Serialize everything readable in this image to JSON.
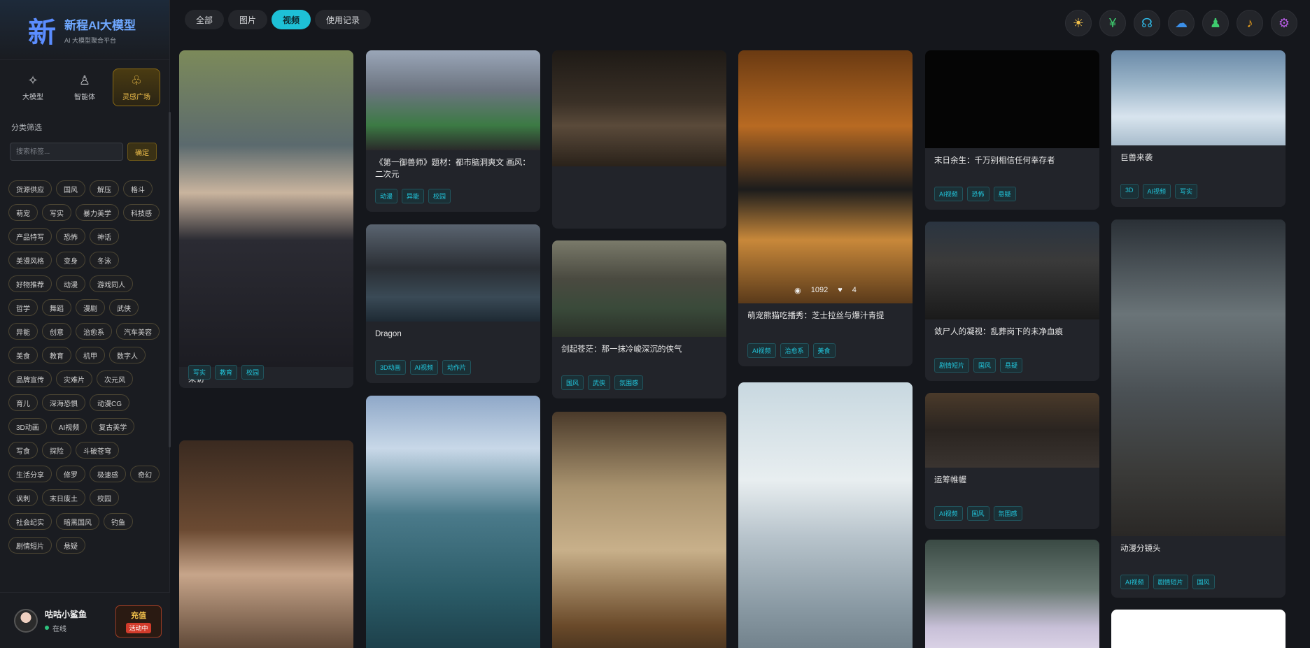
{
  "brand": {
    "logo": "新",
    "title": "新程AI大模型",
    "subtitle": "AI 大模型聚合平台"
  },
  "nav": [
    {
      "label": "大模型",
      "icon": "✧"
    },
    {
      "label": "智能体",
      "icon": "♙"
    },
    {
      "label": "灵感广场",
      "icon": "♧"
    }
  ],
  "filter": {
    "title": "分类筛选",
    "placeholder": "搜索标签...",
    "confirm": "确定"
  },
  "tags": [
    "货源供应",
    "国风",
    "解压",
    "格斗",
    "萌宠",
    "写实",
    "暴力美学",
    "科技感",
    "产品特写",
    "恐怖",
    "神话",
    "美漫风格",
    "变身",
    "冬泳",
    "好物推荐",
    "动漫",
    "游戏同人",
    "哲学",
    "舞蹈",
    "漫剧",
    "武侠",
    "异能",
    "创意",
    "治愈系",
    "汽车美容",
    "美食",
    "教育",
    "机甲",
    "数字人",
    "品牌宣传",
    "灾难片",
    "次元风",
    "育儿",
    "深海恐惧",
    "动漫CG",
    "3D动画",
    "AI视频",
    "复古美学",
    "写食",
    "探险",
    "斗破苍穹",
    "生活分享",
    "修罗",
    "极速感",
    "奇幻",
    "讽刺",
    "末日废土",
    "校园",
    "社会纪实",
    "暗黑国风",
    "钓鱼",
    "剧情短片",
    "悬疑"
  ],
  "user": {
    "name": "咕咕小鲨鱼",
    "status": "在线",
    "recharge": "充值",
    "badge": "活动中"
  },
  "filter_tabs": [
    "全部",
    "图片",
    "视频",
    "使用记录"
  ],
  "cards": [
    {
      "title": "采访",
      "tags": [
        "写实",
        "教育",
        "校园"
      ]
    },
    {
      "title": "",
      "tags": []
    },
    {
      "title": "《第一御兽师》题材：都市脑洞爽文 画风：二次元",
      "tags": [
        "动漫",
        "异能",
        "校园"
      ]
    },
    {
      "title": "Dragon",
      "tags": [
        "3D动画",
        "AI视频",
        "动作片"
      ]
    },
    {
      "title": "",
      "tags": []
    },
    {
      "title": "",
      "tags": []
    },
    {
      "title": "剑起苍茫：那一抹冷峻深沉的侠气",
      "tags": [
        "国风",
        "武侠",
        "氛围感"
      ]
    },
    {
      "title": "",
      "tags": []
    },
    {
      "title": "萌宠熊猫吃播秀：芝士拉丝与爆汁青提",
      "tags": [
        "AI视频",
        "治愈系",
        "美食"
      ],
      "views": "1092",
      "likes": "4"
    },
    {
      "title": "",
      "tags": []
    },
    {
      "title": "末日余生：千万别相信任何幸存者",
      "tags": [
        "AI视频",
        "恐怖",
        "悬疑"
      ]
    },
    {
      "title": "敛尸人的凝视：乱葬岗下的未净血痕",
      "tags": [
        "剧情短片",
        "国风",
        "悬疑"
      ]
    },
    {
      "title": "运筹帷幄",
      "tags": [
        "AI视频",
        "国风",
        "氛围感"
      ]
    },
    {
      "title": "",
      "tags": []
    },
    {
      "title": "巨兽来袭",
      "tags": [
        "3D",
        "AI视频",
        "写实"
      ]
    },
    {
      "title": "动漫分镜头",
      "tags": [
        "AI视频",
        "剧情短片",
        "国风"
      ]
    },
    {
      "title": "",
      "tags": []
    }
  ]
}
